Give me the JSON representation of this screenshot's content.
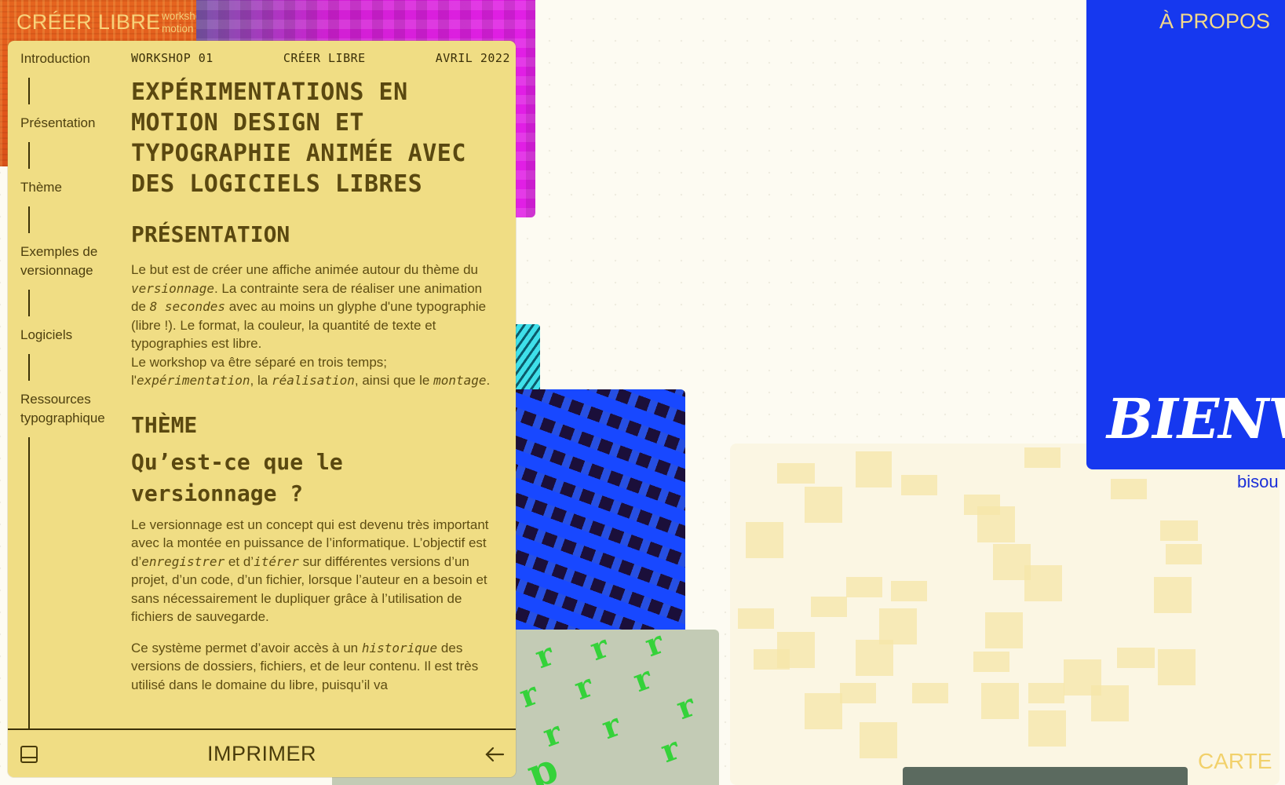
{
  "brand": {
    "title": "CRÉER LIBRE",
    "subtitle_line1": "workshop",
    "subtitle_line2": "motion design et typographie animée"
  },
  "topnav": {
    "about": "À PROPOS",
    "map": "CARTE"
  },
  "hero": {
    "welcome_fragment": "BIENV",
    "bisou_fragment": "bisou"
  },
  "sidebar": {
    "items": [
      {
        "label": "Introduction"
      },
      {
        "label": "Présentation"
      },
      {
        "label": "Thème"
      },
      {
        "label": "Exemples de versionnage"
      },
      {
        "label": "Logiciels"
      },
      {
        "label": "Ressources typographique"
      }
    ]
  },
  "meta": {
    "workshop": "WORKSHOP 01",
    "project": "CRÉER LIBRE",
    "date": "AVRIL 2022"
  },
  "article": {
    "title": "EXPÉRIMENTATIONS EN MOTION DESIGN ET TYPOGRAPHIE ANIMÉE AVEC DES LOGICIELS LIBRES",
    "presentation_heading": "PRÉSENTATION",
    "presentation_p1_a": "Le but est de créer une affiche animée autour du thème du ",
    "presentation_p1_em1": "versionnage",
    "presentation_p1_b": ". La contrainte sera de réaliser une animation de ",
    "presentation_p1_em2": "8 secondes",
    "presentation_p1_c": " avec au moins un glyphe d'une typographie (libre !). Le format, la couleur, la quantité de texte et typographies est libre.",
    "presentation_p2_a": "Le workshop va être séparé en trois temps; l'",
    "presentation_p2_em1": "expérimentation",
    "presentation_p2_b": ", la ",
    "presentation_p2_em2": "réalisation",
    "presentation_p2_c": ", ainsi que le ",
    "presentation_p2_em3": "montage",
    "presentation_p2_d": ".",
    "theme_heading": "THÈME",
    "question_heading": "Qu’est-ce que le versionnage ?",
    "theme_p1_a": "Le versionnage est un concept qui est devenu très important avec la montée en puissance de l’informatique. L’objectif est d’",
    "theme_p1_em1": "enregistrer",
    "theme_p1_b": " et d’",
    "theme_p1_em2": "itérer",
    "theme_p1_c": " sur différentes versions d’un projet, d’un code, d’un fichier, lorsque l’auteur en a besoin et sans nécessairement le dupliquer grâce à l’utilisation de fichiers de sauvegarde.",
    "theme_p2_a": "Ce système permet d’avoir accès à un ",
    "theme_p2_em1": "historique",
    "theme_p2_b": " des versions de dossiers, fichiers, et de leur contenu. Il est très utilisé dans le domaine du libre, puisqu’il va"
  },
  "toolbar": {
    "print_label": "IMPRIMER",
    "left_icon": "panel-icon",
    "right_icon": "arrow-left-icon"
  },
  "colors": {
    "panel": "#f0dd84",
    "accent_blue": "#1638ef",
    "brand_orange": "#e2581b",
    "magenta": "#e21fe6",
    "text_dark": "#3b3008"
  }
}
